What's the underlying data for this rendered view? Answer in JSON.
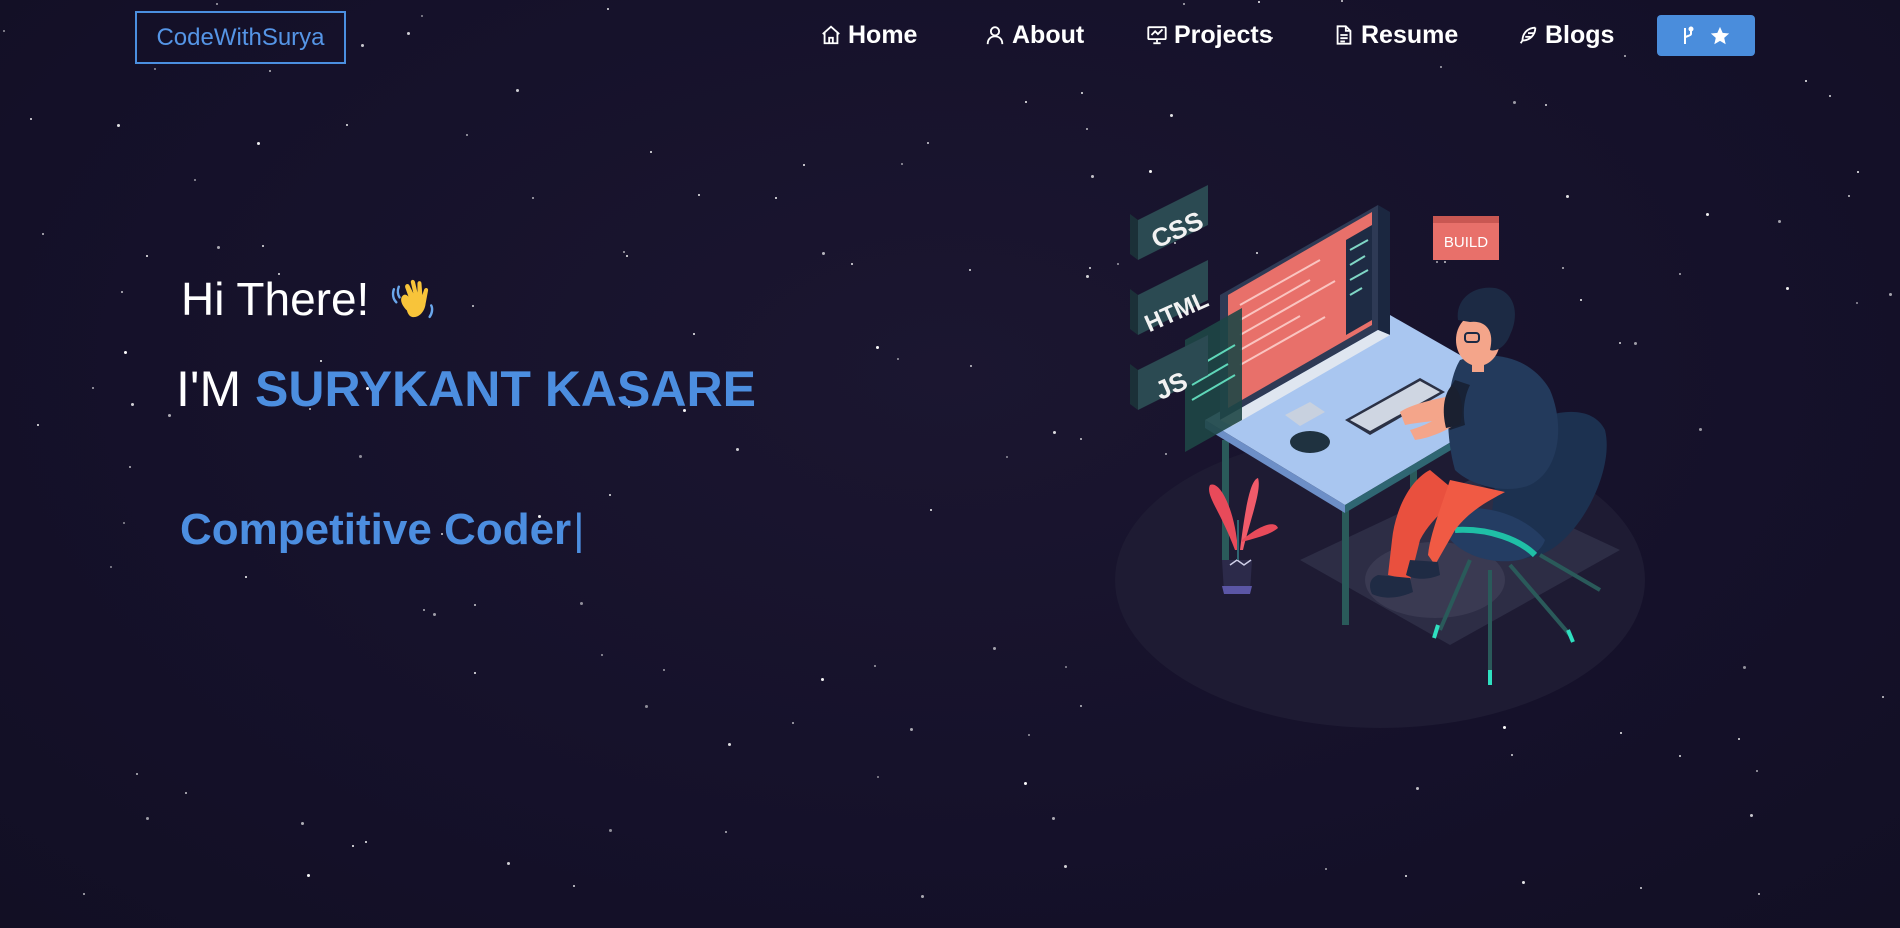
{
  "navbar": {
    "brand": "CodeWithSurya",
    "links": [
      {
        "label": "Home",
        "icon": "home-icon"
      },
      {
        "label": "About",
        "icon": "user-icon"
      },
      {
        "label": "Projects",
        "icon": "presentation-icon"
      },
      {
        "label": "Resume",
        "icon": "document-icon"
      },
      {
        "label": "Blogs",
        "icon": "feather-icon"
      }
    ],
    "github_button": {
      "icons": [
        "git-fork-icon",
        "star-icon"
      ]
    }
  },
  "hero": {
    "greeting": "Hi There!",
    "greeting_emoji": "wave-icon",
    "intro_prefix": "I'M",
    "name": "SURYKANT KASARE",
    "typed_text": "Competitive Coder",
    "typed_cursor": "|"
  },
  "illustration": {
    "labels": [
      "CSS",
      "HTML",
      "JS",
      "BUILD"
    ]
  },
  "colors": {
    "background": "#16122a",
    "accent": "#4c8ee0",
    "button": "#4a8ddc",
    "text": "#ffffff"
  }
}
